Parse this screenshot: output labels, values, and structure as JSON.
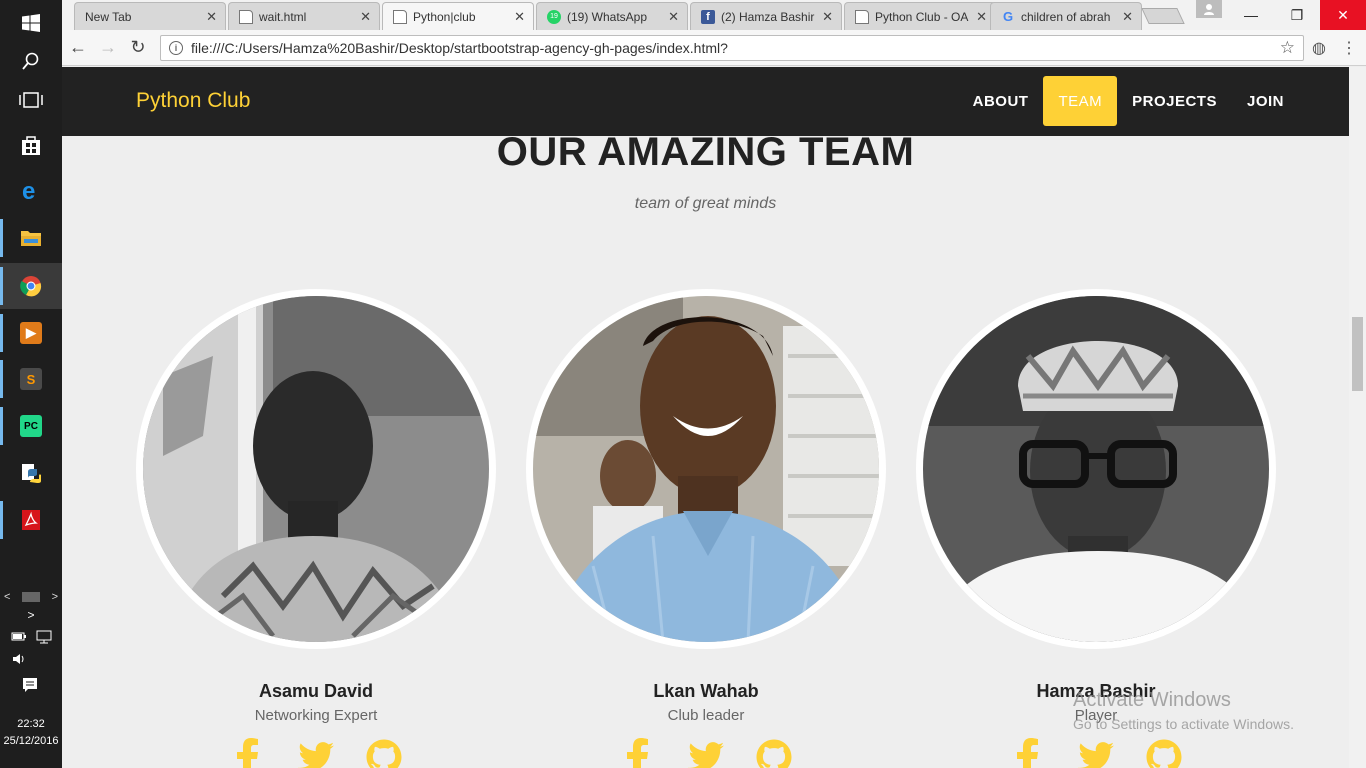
{
  "taskbar": {
    "apps": [
      {
        "name": "start",
        "icon": "windows-logo-icon"
      },
      {
        "name": "search",
        "icon": "search-icon"
      },
      {
        "name": "task-view",
        "icon": "task-view-icon"
      },
      {
        "name": "store",
        "icon": "store-icon"
      },
      {
        "name": "edge",
        "icon": "edge-icon"
      },
      {
        "name": "file-explorer",
        "icon": "folder-icon"
      },
      {
        "name": "chrome",
        "icon": "chrome-icon"
      },
      {
        "name": "media-player",
        "icon": "media-player-icon"
      },
      {
        "name": "sublime-text",
        "icon": "sublime-icon"
      },
      {
        "name": "pycharm",
        "icon": "pycharm-icon",
        "label": "PC"
      },
      {
        "name": "python",
        "icon": "python-icon"
      },
      {
        "name": "acrobat",
        "icon": "pdf-icon"
      }
    ],
    "scroll_left": "<",
    "scroll_right": ">",
    "chevron": ">",
    "time": "22:32",
    "date": "25/12/2016"
  },
  "browser": {
    "tabs": [
      {
        "title": "New Tab",
        "favicon": "none"
      },
      {
        "title": "wait.html",
        "favicon": "doc"
      },
      {
        "title": "Python|club",
        "favicon": "doc",
        "active": true
      },
      {
        "title": "(19) WhatsApp",
        "favicon": "whatsapp",
        "badge": "19"
      },
      {
        "title": "(2) Hamza Bashir",
        "favicon": "facebook"
      },
      {
        "title": "Python Club - OA",
        "favicon": "doc"
      },
      {
        "title": "children of abrah",
        "favicon": "google"
      }
    ],
    "tab_close": "✕",
    "url": "file:///C:/Users/Hamza%20Bashir/Desktop/startbootstrap-agency-gh-pages/index.html?"
  },
  "site": {
    "brand": "Python Club",
    "nav": [
      {
        "label": "ABOUT",
        "active": false
      },
      {
        "label": "TEAM",
        "active": true
      },
      {
        "label": "PROJECTS",
        "active": false
      },
      {
        "label": "JOIN",
        "active": false
      }
    ],
    "team": {
      "heading": "OUR AMAZING TEAM",
      "subheading": "team of great minds",
      "members": [
        {
          "name": "Asamu David",
          "role": "Networking Expert"
        },
        {
          "name": "Lkan Wahab",
          "role": "Club leader"
        },
        {
          "name": "Hamza Bashir",
          "role": "Player"
        }
      ],
      "social_icons": [
        "facebook-icon",
        "twitter-icon",
        "github-icon"
      ]
    }
  },
  "windows_watermark": {
    "line1": "Activate Windows",
    "line2": "Go to Settings to activate Windows."
  },
  "colors": {
    "accent": "#fed136",
    "navbar": "#222222",
    "page_bg": "#eeeeee",
    "close_button": "#e81123"
  }
}
